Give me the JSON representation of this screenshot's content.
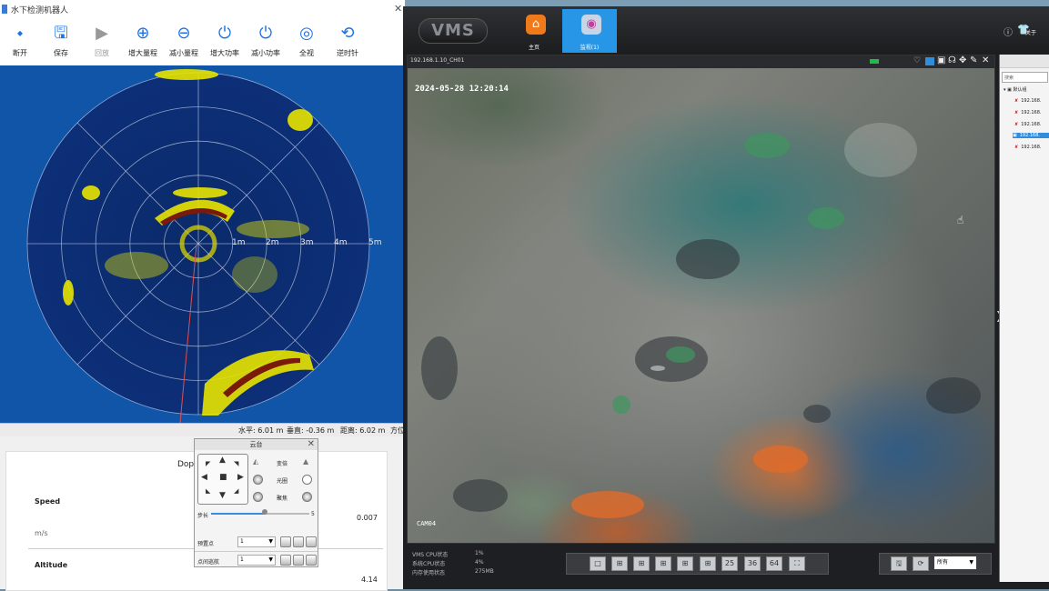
{
  "sonar": {
    "title": "水下检测机器人",
    "toolbar": [
      {
        "label": "断开",
        "icon": "disconnect-icon",
        "glyph": "⬩"
      },
      {
        "label": "保存",
        "icon": "save-icon",
        "glyph": "🖫"
      },
      {
        "label": "回放",
        "icon": "playback-icon",
        "glyph": "▶"
      },
      {
        "label": "增大量程",
        "icon": "range-up-icon",
        "glyph": "⊕"
      },
      {
        "label": "减小量程",
        "icon": "range-down-icon",
        "glyph": "⊖"
      },
      {
        "label": "增大功率",
        "icon": "power-up-icon",
        "glyph": "⏻"
      },
      {
        "label": "减小功率",
        "icon": "power-down-icon",
        "glyph": "⏻"
      },
      {
        "label": "全视",
        "icon": "fullview-icon",
        "glyph": "◎"
      },
      {
        "label": "逆时针",
        "icon": "counterclockwise-icon",
        "glyph": "⟲"
      }
    ],
    "range_labels": [
      "1m",
      "2m",
      "3m",
      "4m",
      "5m"
    ],
    "status": {
      "horizontal": "水平: 6.01 m",
      "vertical": "垂直: -0.36 m",
      "distance": "距离: 6.02 m",
      "bearing": "方位"
    }
  },
  "doppler": {
    "title": "Dopp",
    "speed_label": "Speed",
    "speed_unit": "m/s",
    "speed_value": "0.007",
    "altitude_label": "Altitude",
    "altitude_value": "4.14"
  },
  "ptz": {
    "title": "云台",
    "labels": {
      "zoom": "变倍",
      "focus": "光圈",
      "iris": "聚焦",
      "step": "步长",
      "step_value": "5",
      "preset": "预置点",
      "cruise": "点间巡航"
    },
    "preset_value": "1",
    "cruise_value": "1"
  },
  "vms": {
    "logo": "VMS",
    "tabs": [
      {
        "label": "主页"
      },
      {
        "label": "监视(1)"
      }
    ],
    "about": "关于",
    "camera_title": "192.168.1.10_CH01",
    "timestamp": "2024-05-28 12:20:14",
    "cam_label": "CAM04",
    "device_panel": {
      "search": "搜索",
      "root": "默认组",
      "devices": [
        "192.168.",
        "192.168.",
        "192.168.",
        "192.168.",
        "192.168."
      ]
    },
    "system": {
      "cpu_label": "VMS CPU状态",
      "cpu_value": "1%",
      "sys_cpu_label": "系统CPU状态",
      "sys_cpu_value": "4%",
      "mem_label": "内存使用状态",
      "mem_value": "275MB"
    },
    "layout_buttons": [
      "",
      "",
      "",
      "",
      "",
      "",
      "25",
      "36",
      "64",
      ""
    ],
    "filter_value": "所有"
  }
}
